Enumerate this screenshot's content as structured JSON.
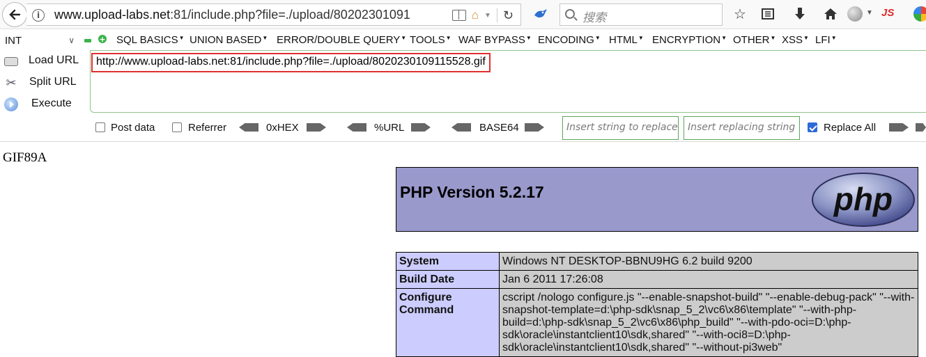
{
  "browser": {
    "url_prefix": "www.upload-labs.net",
    "url_rest": ":81/include.php?file=./upload/80202301091",
    "search_placeholder": "搜索",
    "js_label": "JS"
  },
  "hackbar": {
    "int_select": "INT",
    "menu": [
      "SQL BASICS",
      "UNION BASED",
      "ERROR/DOUBLE QUERY",
      "TOOLS",
      "WAF BYPASS",
      "ENCODING",
      "HTML",
      "ENCRYPTION",
      "OTHER",
      "XSS",
      "LFI"
    ],
    "load_url": "Load URL",
    "split_url": "Split URL",
    "execute": "Execute",
    "url_value": "http://www.upload-labs.net:81/include.php?file=./upload/8020230109115528.gif",
    "post_data": "Post data",
    "referrer": "Referrer",
    "hex": "0xHEX",
    "urlenc": "%URL",
    "base64": "BASE64",
    "insert_replace_placeholder": "Insert string to replace",
    "insert_replacing_placeholder": "Insert replacing string",
    "replace_all": "Replace All",
    "replace_all_checked": true
  },
  "page": {
    "gif_header": "GIF89A",
    "php_version": "PHP Version 5.2.17",
    "logo_text": "php",
    "rows": [
      {
        "key": "System",
        "value": "Windows NT DESKTOP-BBNU9HG 6.2 build 9200"
      },
      {
        "key": "Build Date",
        "value": "Jan 6 2011 17:26:08"
      },
      {
        "key": "Configure Command",
        "value": "cscript /nologo configure.js \"--enable-snapshot-build\" \"--enable-debug-pack\" \"--with-snapshot-template=d:\\php-sdk\\snap_5_2\\vc6\\x86\\template\" \"--with-php-build=d:\\php-sdk\\snap_5_2\\vc6\\x86\\php_build\" \"--with-pdo-oci=D:\\php-sdk\\oracle\\instantclient10\\sdk,shared\" \"--with-oci8=D:\\php-sdk\\oracle\\instantclient10\\sdk,shared\" \"--without-pi3web\""
      }
    ]
  }
}
